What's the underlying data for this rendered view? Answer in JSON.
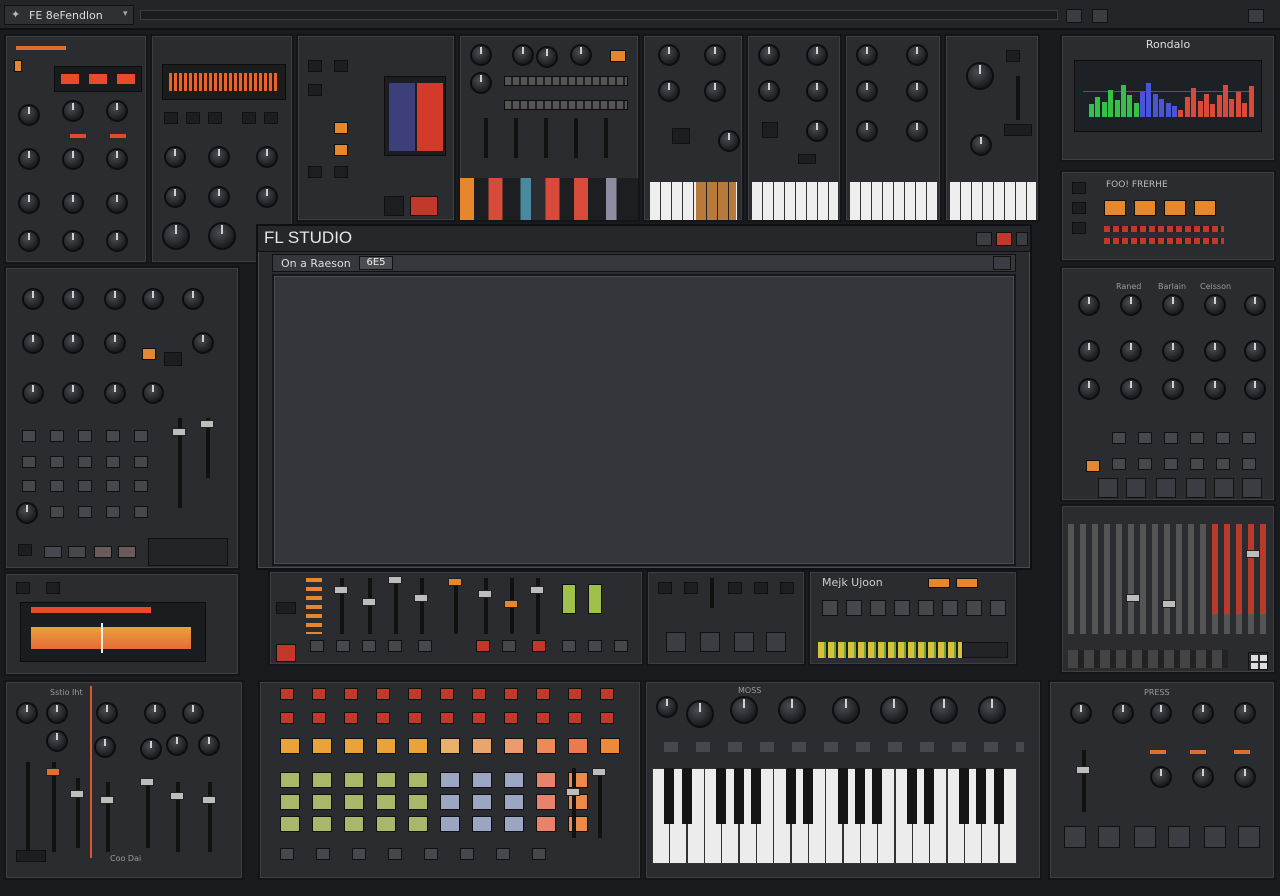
{
  "app": {
    "title": "FL Studio",
    "toolbar_title": "FE 8eFendlon",
    "toolbar_arrow": "▾"
  },
  "dialog": {
    "title": "FL STUDIO",
    "subheader_label": "On a Raeson",
    "subheader_badge": "6E5"
  },
  "right_display": {
    "title": "Rondalo",
    "bars": [
      {
        "color": "#35c04a",
        "value": 0.35
      },
      {
        "color": "#35c04a",
        "value": 0.55
      },
      {
        "color": "#35c04a",
        "value": 0.42
      },
      {
        "color": "#35c04a",
        "value": 0.75
      },
      {
        "color": "#35c04a",
        "value": 0.48
      },
      {
        "color": "#35c04a",
        "value": 0.9
      },
      {
        "color": "#35c04a",
        "value": 0.6
      },
      {
        "color": "#35c04a",
        "value": 0.38
      },
      {
        "color": "#4a54d8",
        "value": 0.7
      },
      {
        "color": "#4a54d8",
        "value": 0.95
      },
      {
        "color": "#4a54d8",
        "value": 0.65
      },
      {
        "color": "#4a54d8",
        "value": 0.5
      },
      {
        "color": "#4a54d8",
        "value": 0.4
      },
      {
        "color": "#4a54d8",
        "value": 0.3
      },
      {
        "color": "#d84a3a",
        "value": 0.2
      },
      {
        "color": "#d84a3a",
        "value": 0.55
      },
      {
        "color": "#d84a3a",
        "value": 0.8
      },
      {
        "color": "#d84a3a",
        "value": 0.45
      },
      {
        "color": "#d84a3a",
        "value": 0.65
      },
      {
        "color": "#d84a3a",
        "value": 0.35
      },
      {
        "color": "#d84a3a",
        "value": 0.6
      },
      {
        "color": "#d84a3a",
        "value": 0.9
      },
      {
        "color": "#d84a3a",
        "value": 0.5
      },
      {
        "color": "#d84a3a",
        "value": 0.7
      },
      {
        "color": "#d84a3a",
        "value": 0.4
      },
      {
        "color": "#d84a3a",
        "value": 0.85
      }
    ]
  },
  "rack_labels": {
    "mixer_strip": "Mejk Ujoon",
    "knob_bank_a": "Raned",
    "knob_bank_b": "Barlain",
    "knob_bank_c": "Ceisson",
    "synth_bank": "MOSS",
    "keys_bank": "PRESS",
    "step_bank": "Sstio Iht",
    "bottom_left": "Coo Dai",
    "seq_header": "FOO! FRERHE"
  },
  "colors": {
    "accent": "#e6862d",
    "danger": "#c2382a",
    "panel": "#2b2c30",
    "screen": "#34363b"
  }
}
